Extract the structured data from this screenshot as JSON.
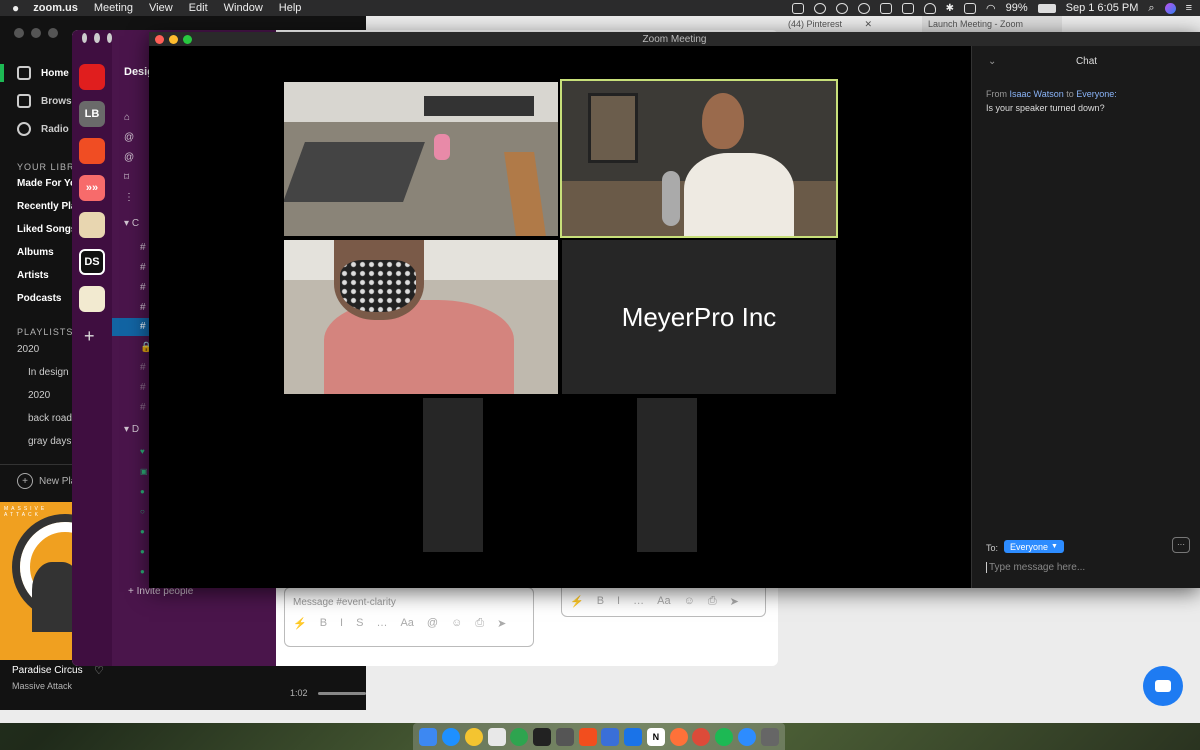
{
  "menubar": {
    "apple": "",
    "app_name": "zoom.us",
    "menus": [
      "Meeting",
      "View",
      "Edit",
      "Window",
      "Help"
    ],
    "battery": "99%",
    "datetime": "Sep 1  6:05 PM"
  },
  "browser": {
    "tab1": "(44) Pinterest",
    "tab2": "Launch Meeting - Zoom"
  },
  "spotify": {
    "nav": [
      "Home",
      "Browse",
      "Radio"
    ],
    "your_library_label": "YOUR LIBRARY",
    "library": [
      "Made For You",
      "Recently Played",
      "Liked Songs",
      "Albums",
      "Artists",
      "Podcasts"
    ],
    "playlists_label": "PLAYLISTS",
    "playlists": [
      "2020",
      "In design",
      "2020",
      "back roads",
      "gray days"
    ],
    "new_playlist": "New Playlist",
    "album_text": "MASSIVE ATTACK",
    "now_playing_title": "Paradise Circus",
    "now_playing_artist": "Massive Attack",
    "elapsed": "1:02"
  },
  "slack": {
    "workspaces": [
      {
        "label": "",
        "color": "#e01e1e"
      },
      {
        "label": "LB",
        "color": "#6a6a6a"
      },
      {
        "label": "",
        "color": "#f04d23"
      },
      {
        "label": "»»",
        "color": "#f76b6b"
      },
      {
        "label": "",
        "color": "#e8d6b0"
      },
      {
        "label": "DS",
        "color": "#111111"
      },
      {
        "label": "",
        "color": "#f2ead0"
      }
    ],
    "add": "+",
    "workspace_title": "Design",
    "channels_header": "C",
    "dm_header": "D",
    "invite_people": "+ Invite people",
    "composer_placeholder": "Message #event-clarity",
    "toolbar_icons": [
      "⚡",
      "B",
      "I",
      "S",
      "…",
      "Aa",
      "@",
      "☺",
      "⎙",
      "➤"
    ]
  },
  "zoom": {
    "window_title": "Zoom Meeting",
    "name_tile": "MeyerPro Inc",
    "chat": {
      "title": "Chat",
      "from_prefix": "From",
      "sender": "Isaac Watson",
      "to_word": "to",
      "recipient": "Everyone:",
      "message": "Is your speaker turned down?",
      "to_label": "To:",
      "to_value": "Everyone",
      "input_placeholder": "Type message here...",
      "more": "···"
    }
  },
  "colors": {
    "zoom_accent": "#2d8cff",
    "active_speaker": "#c8e07a",
    "slack_purple": "#4a154b"
  }
}
